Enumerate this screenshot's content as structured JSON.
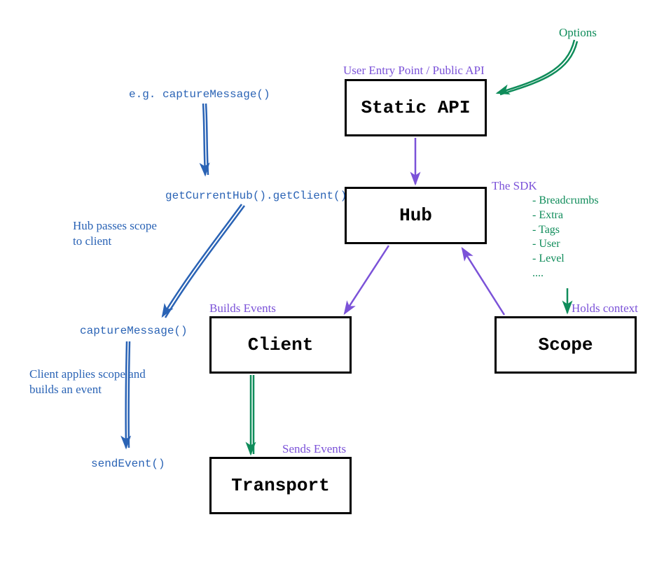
{
  "boxes": {
    "staticApi": {
      "label": "Static API",
      "caption": "User Entry Point / Public API"
    },
    "hub": {
      "label": "Hub",
      "caption": "The SDK"
    },
    "client": {
      "label": "Client",
      "caption": "Builds Events"
    },
    "scope": {
      "label": "Scope",
      "caption": "Holds context"
    },
    "transport": {
      "label": "Transport",
      "caption": "Sends Events"
    }
  },
  "flow": {
    "step1": "e.g. captureMessage()",
    "step2": "getCurrentHub().getClient()",
    "step2note": "Hub passes scope\nto client",
    "step3": "captureMessage()",
    "step3note": "Client applies scope and\nbuilds an event",
    "step4": "sendEvent()"
  },
  "annotations": {
    "options": "Options",
    "scopeList": "- Breadcrumbs\n- Extra\n- Tags\n- User\n- Level\n...."
  },
  "colors": {
    "blue": "#2a63b5",
    "purple": "#7b52d8",
    "green": "#0f8c5a",
    "black": "#000000"
  }
}
